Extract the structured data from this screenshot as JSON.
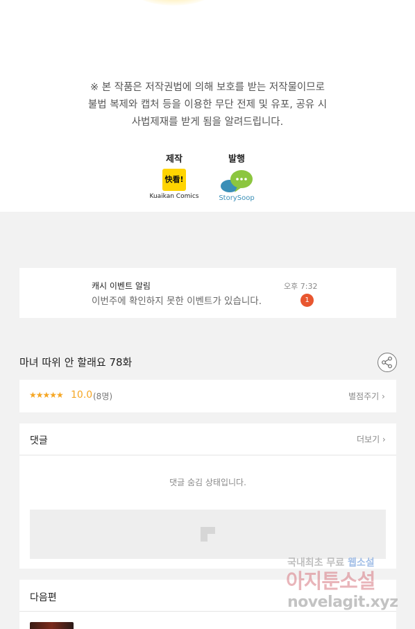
{
  "copyright_notice": {
    "lines": [
      "※ 본 작품은 저작권법에 의해 보호를 받는 저작물이므로",
      "불법 복제와 캡처 등을  이용한 무단 전제 및 유포, 공유 시",
      "사법제재를  받게 됨을 알려드립니다."
    ]
  },
  "credits": {
    "production_label": "제작",
    "production_logo_text": "快看!",
    "production_name": "Kuaikan Comics",
    "publisher_label": "발행",
    "publisher_name": "StorySoop"
  },
  "event_notification": {
    "title": "캐시 이벤트 알림",
    "message": "이번주에 확인하지 못한 이벤트가 있습니다.",
    "time": "오후 7:32",
    "badge_count": "1"
  },
  "episode": {
    "title": "마녀 따위 안 할래요 78화"
  },
  "rating": {
    "stars": "★★★★★",
    "score": "10.0",
    "count": "(8명)",
    "rate_link": "별점주기 ›"
  },
  "comments": {
    "header": "댓글",
    "more_link": "더보기 ›",
    "hidden_message": "댓글 숨김 상태입니다."
  },
  "next_episode": {
    "header": "다음편"
  },
  "watermark": {
    "line1_prefix": "국내최초 무료 ",
    "line1_highlight": "웹소설",
    "line2": "아지툰소설",
    "line3": "novelagit.xyz"
  },
  "colors": {
    "accent_orange": "#f5a623",
    "badge_red": "#e8562f",
    "kuaikan_yellow": "#ffd400",
    "background": "#f2f2f2"
  }
}
